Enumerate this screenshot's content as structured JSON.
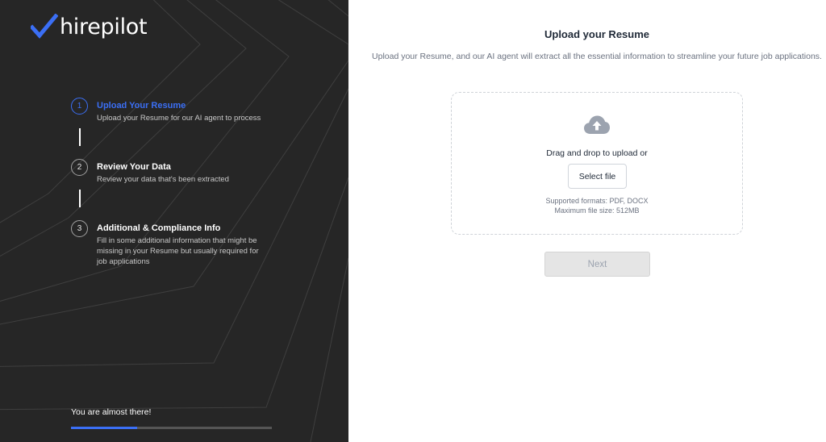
{
  "brand": {
    "name": "hirepilot",
    "accent_color": "#3b6ff5",
    "sidebar_bg": "#262626"
  },
  "steps": [
    {
      "number": "1",
      "title": "Upload Your Resume",
      "description": "Upload your Resume for our AI agent to process",
      "state": "active"
    },
    {
      "number": "2",
      "title": "Review Your Data",
      "description": "Review your data that's been extracted",
      "state": "pending"
    },
    {
      "number": "3",
      "title": "Additional & Compliance Info",
      "description": "Fill in some additional information that might be missing in your Resume but usually required for job applications",
      "state": "pending"
    }
  ],
  "progress": {
    "label": "You are almost there!",
    "percent": 33
  },
  "upload": {
    "title": "Upload your Resume",
    "subtitle": "Upload your Resume, and our AI agent will extract all the essential information to streamline your future job applications.",
    "icon": "cloud-upload-icon",
    "drag_text": "Drag and drop to upload or",
    "select_label": "Select file",
    "formats": "Supported formats: PDF, DOCX",
    "max_size": "Maximum file size: 512MB"
  },
  "actions": {
    "next_label": "Next",
    "next_disabled": true
  }
}
